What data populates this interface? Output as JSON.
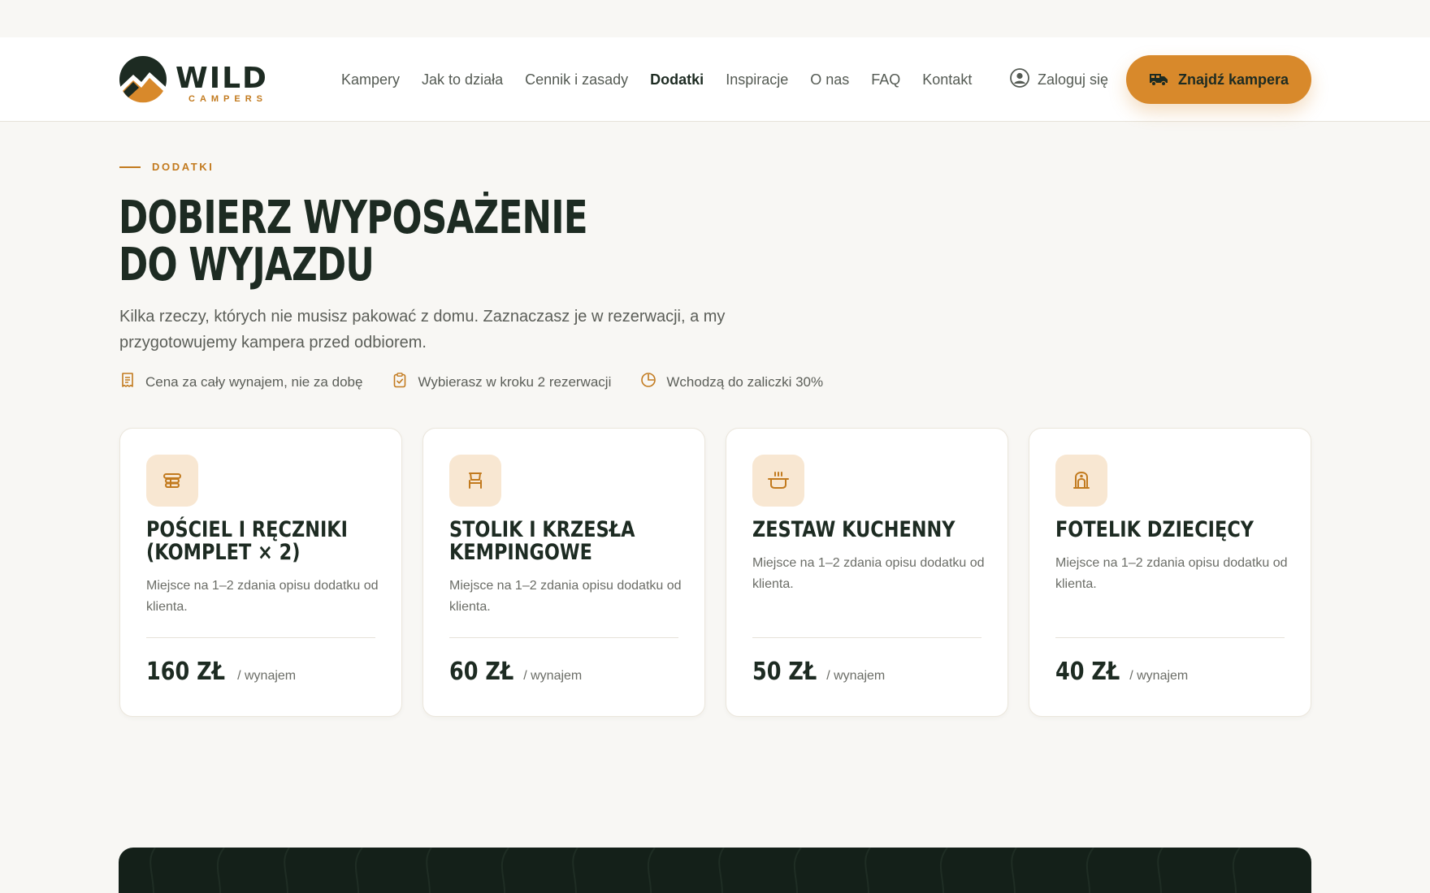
{
  "brand": {
    "name": "WILD",
    "sub": "CAMPERS",
    "colors": {
      "dark": "#1d2b22",
      "accent": "#d8892b",
      "accent_text": "#c27a1e",
      "background": "#f8f7f4"
    }
  },
  "nav": {
    "items": [
      {
        "label": "Kampery",
        "active": false
      },
      {
        "label": "Jak to działa",
        "active": false
      },
      {
        "label": "Cennik i zasady",
        "active": false
      },
      {
        "label": "Dodatki",
        "active": true
      },
      {
        "label": "Inspiracje",
        "active": false
      },
      {
        "label": "O nas",
        "active": false
      },
      {
        "label": "FAQ",
        "active": false
      },
      {
        "label": "Kontakt",
        "active": false
      }
    ],
    "login_label": "Zaloguj się",
    "login_icon": "user-circle-icon",
    "cta_label": "Znajdź kampera",
    "cta_icon": "camper-van-icon"
  },
  "hero": {
    "eyebrow": "DODATKI",
    "title_line1": "DOBIERZ WYPOSAŻENIE",
    "title_line2": "DO WYJAZDU",
    "lead": "Kilka rzeczy, których nie musisz pakować z domu. Zaznaczasz je w rezerwacji, a my przygotowujemy kampera przed odbiorem.",
    "features": [
      {
        "icon": "receipt-icon",
        "label": "Cena za cały wynajem, nie za dobę"
      },
      {
        "icon": "clipboard-check-icon",
        "label": "Wybierasz w kroku 2 rezerwacji"
      },
      {
        "icon": "pie-clock-icon",
        "label": "Wchodzą do zaliczki 30%"
      }
    ]
  },
  "addons": [
    {
      "icon": "bedding-towels-icon",
      "title": "Pościel i ręczniki (komplet × 2)",
      "description": "Miejsce na 1–2 zdania opisu dodatku od klienta.",
      "price": "160 ZŁ",
      "unit": "/ wynajem"
    },
    {
      "icon": "camping-chair-icon",
      "title": "Stolik i krzesła kempingowe",
      "description": "Miejsce na 1–2 zdania opisu dodatku od klienta.",
      "price": "60 ZŁ",
      "unit": "/ wynajem"
    },
    {
      "icon": "cooking-pot-icon",
      "title": "Zestaw kuchenny",
      "description": "Miejsce na 1–2 zdania opisu dodatku od klienta.",
      "price": "50 ZŁ",
      "unit": "/ wynajem"
    },
    {
      "icon": "child-seat-icon",
      "title": "Fotelik dziecięcy",
      "description": "Miejsce na 1–2 zdania opisu dodatku od klienta.",
      "price": "40 ZŁ",
      "unit": "/ wynajem"
    }
  ]
}
